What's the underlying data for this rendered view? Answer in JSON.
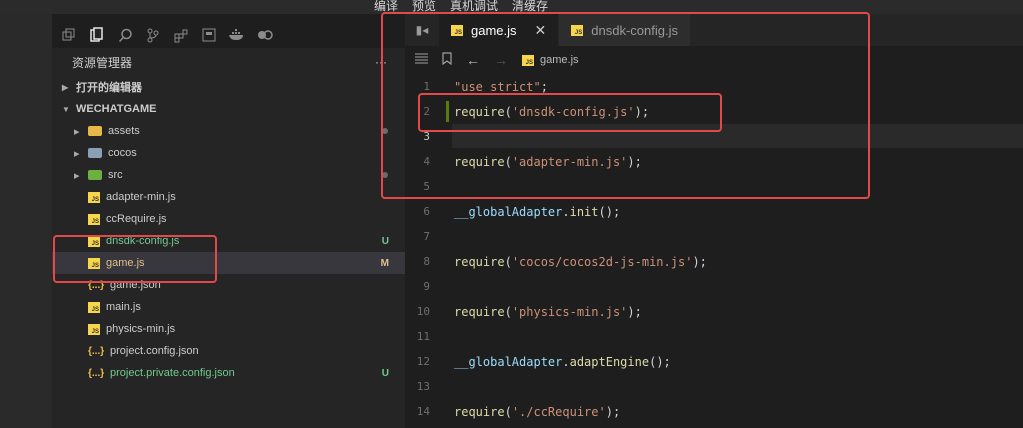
{
  "top_menu": [
    "编译",
    "预览",
    "真机调试",
    "清缓存"
  ],
  "sidebar": {
    "title": "资源管理器",
    "more": "···",
    "sections": {
      "open_editors": "打开的编辑器",
      "project": "WECHATGAME"
    },
    "items": [
      {
        "name": "assets",
        "type": "folder",
        "color": "#e8b84b",
        "expand": "▸",
        "dot": true
      },
      {
        "name": "cocos",
        "type": "folder",
        "color": "#8aa0b5",
        "expand": "▸",
        "dot": false
      },
      {
        "name": "src",
        "type": "folder",
        "color": "#6cb040",
        "expand": "▸",
        "dot": true
      },
      {
        "name": "adapter-min.js",
        "type": "js"
      },
      {
        "name": "ccRequire.js",
        "type": "js"
      },
      {
        "name": "dnsdk-config.js",
        "type": "js",
        "badge": "U",
        "color": "#73c991"
      },
      {
        "name": "game.js",
        "type": "js",
        "badge": "M",
        "color": "#e2c08d",
        "selected": true
      },
      {
        "name": "game.json",
        "type": "json"
      },
      {
        "name": "main.js",
        "type": "js"
      },
      {
        "name": "physics-min.js",
        "type": "js"
      },
      {
        "name": "project.config.json",
        "type": "json"
      },
      {
        "name": "project.private.config.json",
        "type": "json",
        "badge": "U",
        "color": "#73c991"
      }
    ],
    "json_icon": "{...}"
  },
  "tabs": [
    {
      "label": "game.js",
      "active": true,
      "close": "✕"
    },
    {
      "label": "dnsdk-config.js",
      "active": false
    }
  ],
  "breadcrumb": "game.js",
  "code": [
    {
      "n": "1",
      "parts": [
        [
          "s",
          "\"use strict\""
        ],
        [
          "p",
          ";"
        ]
      ]
    },
    {
      "n": "2",
      "parts": [
        [
          "f",
          "require"
        ],
        [
          "p",
          "("
        ],
        [
          "s",
          "'dnsdk-config.js'"
        ],
        [
          "p",
          ");"
        ]
      ],
      "modified": true
    },
    {
      "n": "3",
      "parts": [],
      "current": true
    },
    {
      "n": "4",
      "parts": [
        [
          "f",
          "require"
        ],
        [
          "p",
          "("
        ],
        [
          "s",
          "'adapter-min.js'"
        ],
        [
          "p",
          ");"
        ]
      ]
    },
    {
      "n": "5",
      "parts": []
    },
    {
      "n": "6",
      "parts": [
        [
          "k",
          "__globalAdapter"
        ],
        [
          "p",
          "."
        ],
        [
          "f",
          "init"
        ],
        [
          "p",
          "();"
        ]
      ]
    },
    {
      "n": "7",
      "parts": []
    },
    {
      "n": "8",
      "parts": [
        [
          "f",
          "require"
        ],
        [
          "p",
          "("
        ],
        [
          "s",
          "'cocos/cocos2d-js-min.js'"
        ],
        [
          "p",
          ");"
        ]
      ]
    },
    {
      "n": "9",
      "parts": []
    },
    {
      "n": "10",
      "parts": [
        [
          "f",
          "require"
        ],
        [
          "p",
          "("
        ],
        [
          "s",
          "'physics-min.js'"
        ],
        [
          "p",
          ");"
        ]
      ]
    },
    {
      "n": "11",
      "parts": []
    },
    {
      "n": "12",
      "parts": [
        [
          "k",
          "__globalAdapter"
        ],
        [
          "p",
          "."
        ],
        [
          "f",
          "adaptEngine"
        ],
        [
          "p",
          "();"
        ]
      ]
    },
    {
      "n": "13",
      "parts": []
    },
    {
      "n": "14",
      "parts": [
        [
          "f",
          "require"
        ],
        [
          "p",
          "("
        ],
        [
          "s",
          "'./ccRequire'"
        ],
        [
          "p",
          ");"
        ]
      ]
    }
  ]
}
